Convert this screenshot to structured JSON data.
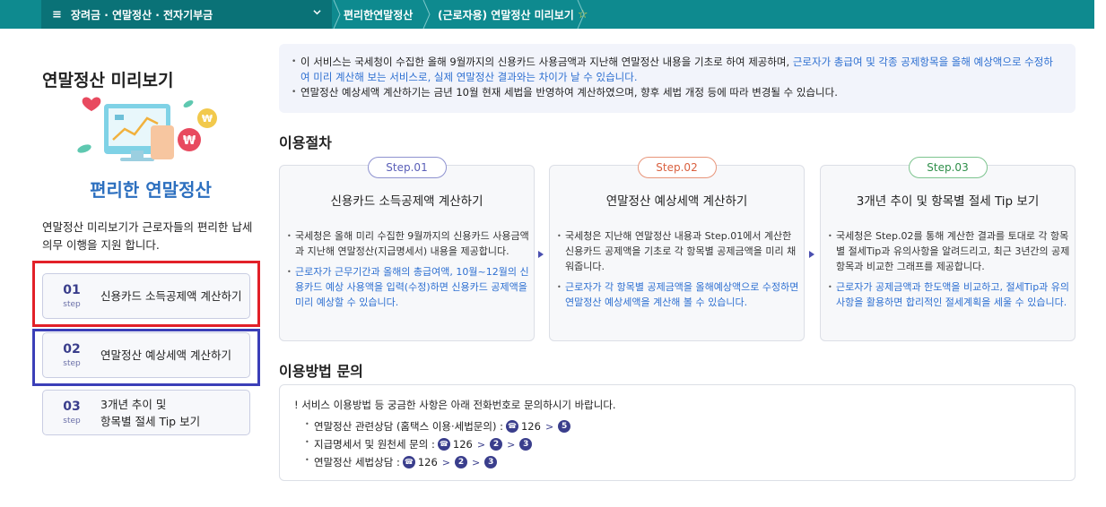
{
  "topbar": {
    "menu_label": "장려금 · 연말정산 · 전자기부금",
    "breadcrumb_1": "편리한연말정산",
    "breadcrumb_2": "(근로자용) 연말정산 미리보기"
  },
  "sidebar": {
    "title": "연말정산 미리보기",
    "illustration_label": "편리한 연말정산",
    "description": "연말정산 미리보기가 근로자들의  편리한 납세 의무 이행을 지원 합니다.",
    "step_word": "step",
    "steps": [
      {
        "num": "01",
        "label": "신용카드 소득공제액 계산하기"
      },
      {
        "num": "02",
        "label": "연말정산 예상세액 계산하기"
      },
      {
        "num": "03",
        "label_1": "3개년 추이 및",
        "label_2": "항목별 절세 Tip 보기"
      }
    ]
  },
  "notice": {
    "line1_a": "이 서비스는 국세청이 수집한 올해 9월까지의 신용카드 사용금액과 지난해 연말정산 내용을 기초로 하여 제공하며, ",
    "line1_b": "근로자가 총급여 및 각종 공제항목을 올해 예상액으로 수정하여 미리 계산해 보는 서비스로, 실제 연말정산 결과와는 차이가 날 수 있습니다.",
    "line2": "연말정산 예상세액 계산하기는 금년 10월 현재 세법을 반영하여 계산하였으며, 향후 세법 개정 등에 따라 변경될 수 있습니다."
  },
  "procedure": {
    "title": "이용절차",
    "steps": [
      {
        "pill": "Step.01",
        "title": "신용카드 소득공제액 계산하기",
        "desc_1": "국세청은 올해 미리 수집한 9월까지의 신용카드 사용금액과 지난해 연말정산(지급명세서) 내용을 제공합니다.",
        "desc_2": "근로자가 근무기간과 올해의 총급여액, 10월~12월의 신용카드 예상 사용액을 입력(수정)하면 신용카드 공제액을 미리 예상할 수 있습니다."
      },
      {
        "pill": "Step.02",
        "title": "연말정산 예상세액 계산하기",
        "desc_1": "국세청은 지난해 연말정산 내용과 Step.01에서 계산한 신용카드 공제액을 기초로 각 항목별 공제금액을 미리 채워줍니다.",
        "desc_2": "근로자가 각 항목별 공제금액을 올해예상액으로 수정하면 연말정산 예상세액을 계산해 볼 수 있습니다."
      },
      {
        "pill": "Step.03",
        "title": "3개년 추이 및 항목별 절세 Tip 보기",
        "desc_1": "국세청은 Step.02를 통해 계산한 결과를 토대로 각 항목별 절세Tip과 유의사항을 알려드리고, 최근 3년간의 공제항목과 비교한 그래프를 제공합니다.",
        "desc_2": "근로자가 공제금액과 한도액을 비교하고, 절세Tip과 유의사항을 활용하면 합리적인 절세계획을 세울 수 있습니다."
      }
    ]
  },
  "contact": {
    "title": "이용방법 문의",
    "lead": "! 서비스 이용방법 등 궁금한 사항은 아래 전화번호로 문의하시기 바랍니다.",
    "rows": [
      {
        "label": "연말정산 관련상담 (홈택스 이용·세법문의) :",
        "number": "126",
        "opt1": "5"
      },
      {
        "label": "지급명세서 및 원천세 문의 :",
        "number": "126",
        "opt1": "2",
        "opt2": "3"
      },
      {
        "label": "연말정산 세법상담 :",
        "number": "126",
        "opt1": "2",
        "opt2": "3"
      }
    ]
  },
  "colors": {
    "teal": "#0e8a8f",
    "step1": "#6b70c4",
    "step2": "#e07050",
    "step3": "#3fa35a",
    "link_blue": "#2d6fd1"
  }
}
